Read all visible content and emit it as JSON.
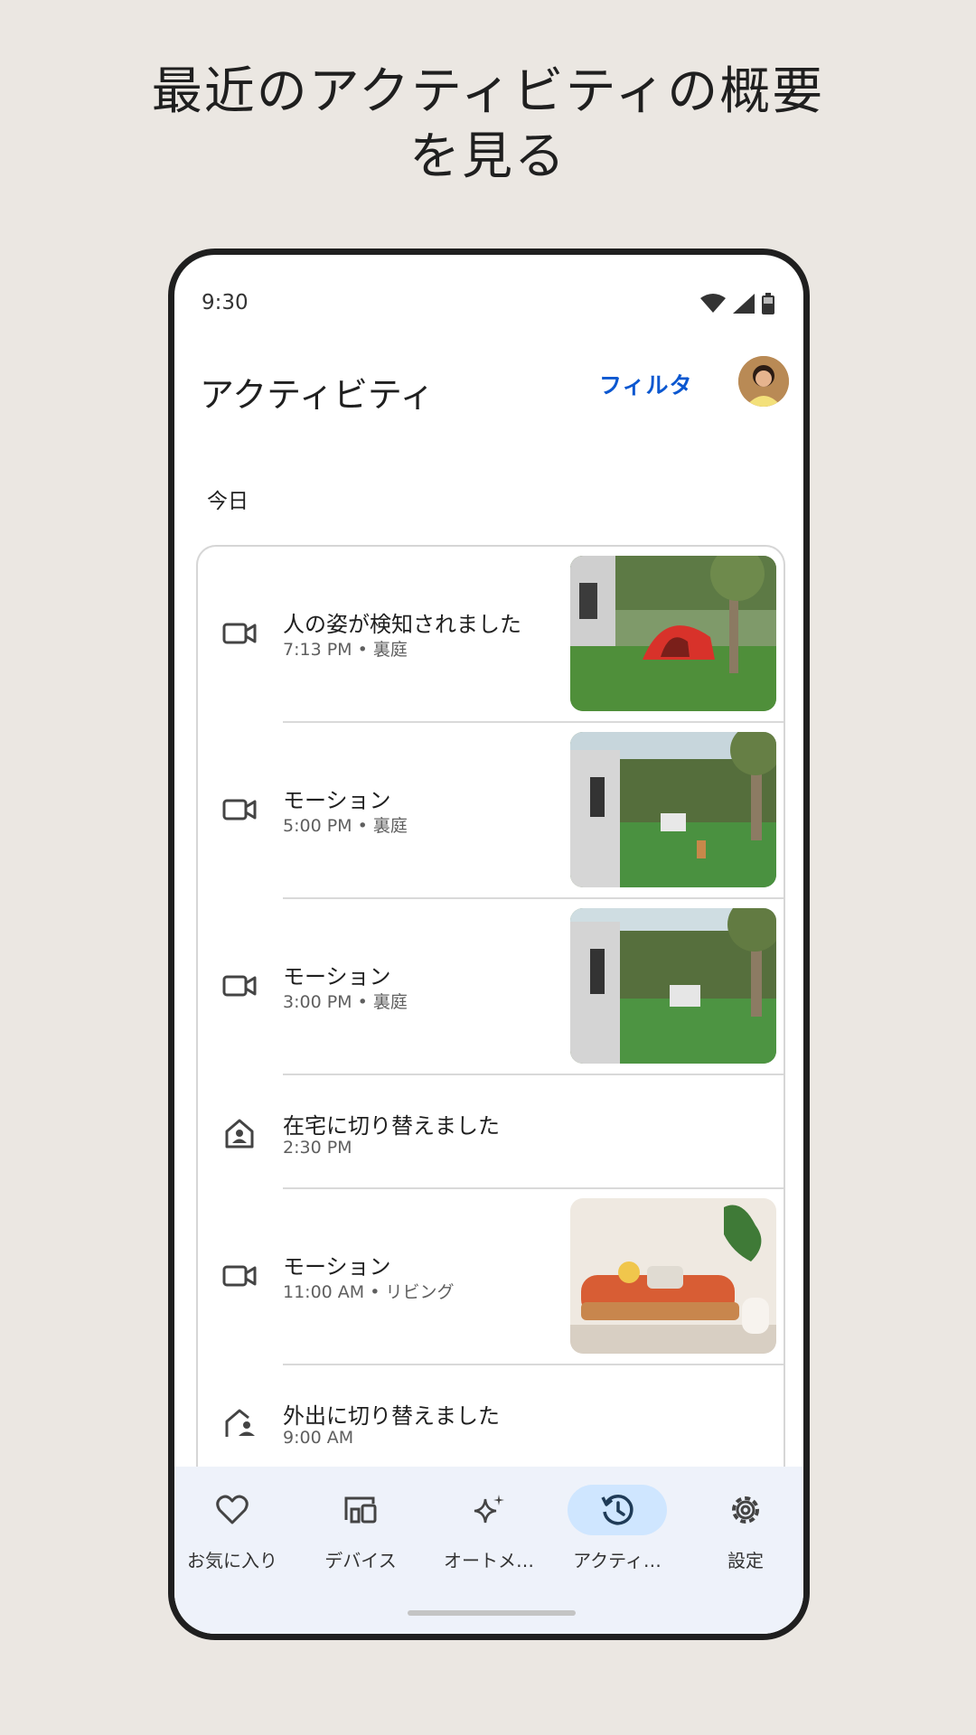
{
  "headline": {
    "line1": "最近のアクティビティの概要",
    "line2": "を見る"
  },
  "status_bar": {
    "time": "9:30",
    "icons": [
      "wifi-icon",
      "signal-icon",
      "battery-icon"
    ]
  },
  "app_bar": {
    "title": "アクティビティ",
    "filter_label": "フィルタ"
  },
  "section": {
    "label": "今日"
  },
  "events": [
    {
      "icon": "camera-icon",
      "title": "人の姿が検知されました",
      "meta": "7:13 PM • 裏庭",
      "thumbnail": "backyard-tent"
    },
    {
      "icon": "camera-icon",
      "title": "モーション",
      "meta": "5:00 PM • 裏庭",
      "thumbnail": "backyard-dog"
    },
    {
      "icon": "camera-icon",
      "title": "モーション",
      "meta": "3:00 PM • 裏庭",
      "thumbnail": "backyard-doghouse"
    },
    {
      "icon": "home-person-icon",
      "title": "在宅に切り替えました",
      "meta": "2:30 PM"
    },
    {
      "icon": "camera-icon",
      "title": "モーション",
      "meta": "11:00 AM • リビング",
      "thumbnail": "living-room-sofa"
    },
    {
      "icon": "away-person-icon",
      "title": "外出に切り替えました",
      "meta": "9:00 AM"
    }
  ],
  "nav": [
    {
      "label": "お気に入り",
      "icon": "heart-icon",
      "active": false
    },
    {
      "label": "デバイス",
      "icon": "devices-icon",
      "active": false
    },
    {
      "label": "オートメ…",
      "icon": "sparkle-icon",
      "active": false
    },
    {
      "label": "アクティ…",
      "icon": "history-icon",
      "active": true
    },
    {
      "label": "設定",
      "icon": "gear-icon",
      "active": false
    }
  ],
  "colors": {
    "accent": "#0b57d0",
    "nav_active": "#cfe6ff",
    "page_bg": "#ebe7e2"
  }
}
